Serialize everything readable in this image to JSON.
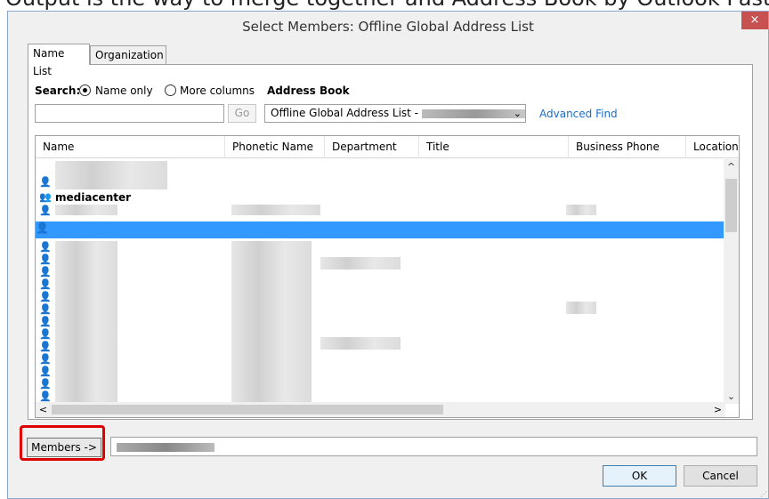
{
  "window": {
    "title": "Select Members: Offline Global Address List",
    "close_glyph": "×"
  },
  "top_strip_text": "Output is the way to merge together and Address Book by Outlook Pasting",
  "tabs": [
    {
      "label": "Name List"
    },
    {
      "label": "Organization"
    }
  ],
  "search": {
    "label": "Search:",
    "opt_name_only": "Name only",
    "opt_more_columns": "More columns",
    "address_book_label": "Address Book",
    "input_value": "",
    "go_label": "Go",
    "address_book_value": "Offline Global Address List -",
    "advanced_find": "Advanced Find"
  },
  "columns": [
    "Name",
    "Phonetic Name",
    "Department",
    "Title",
    "Business Phone",
    "Location"
  ],
  "list": {
    "group_entry": "mediacenter"
  },
  "members_button": "Members ->",
  "buttons": {
    "ok": "OK",
    "cancel": "Cancel"
  },
  "colors": {
    "selection": "#3399ff",
    "highlight_border": "#e00000",
    "link": "#1a6dc7",
    "close_bg": "#c75050"
  }
}
